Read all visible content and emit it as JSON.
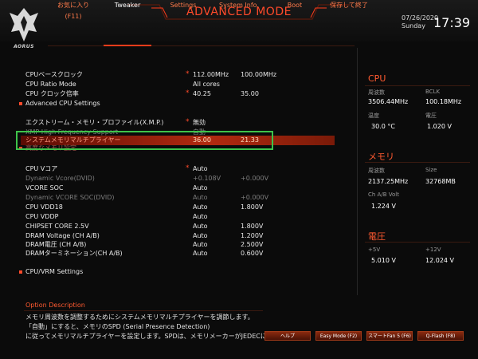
{
  "brand": {
    "logo_text": "AORUS"
  },
  "header": {
    "mode_title": "ADVANCED MODE",
    "date": "07/26/2020",
    "day": "Sunday",
    "time": "17:39"
  },
  "tabs": [
    {
      "label": "お気に入り (F11)"
    },
    {
      "label": "Tweaker",
      "active": true
    },
    {
      "label": "Settings"
    },
    {
      "label": "System Info."
    },
    {
      "label": "Boot"
    },
    {
      "label": "保存して終了"
    }
  ],
  "settings": [
    {
      "label": "CPUベースクロック",
      "star": true,
      "v1": "112.00MHz",
      "v2": "100.00MHz"
    },
    {
      "label": "CPU Ratio Mode",
      "v1": "All cores",
      "v2": ""
    },
    {
      "label": "CPU クロック倍率",
      "star": true,
      "v1": "40.25",
      "v2": "35.00"
    },
    {
      "label": "Advanced CPU Settings"
    },
    {
      "label": "エクストリーム・メモリ・プロファイル(X.M.P.)",
      "star": true,
      "v1": "無効",
      "v2": ""
    },
    {
      "label": "XMP High Frequency Support",
      "v1": "自動",
      "v2": ""
    },
    {
      "label": "システムメモリマルチプライヤー",
      "v1": "36.00",
      "v2": "21.33"
    },
    {
      "label": "高度なメモリ設定"
    },
    {
      "label": "CPU Vコア",
      "star": true,
      "v1": "Auto",
      "v2": ""
    },
    {
      "label": "Dynamic Vcore(DVID)",
      "v1": "+0.108V",
      "v2": "+0.000V"
    },
    {
      "label": "VCORE SOC",
      "v1": "Auto",
      "v2": ""
    },
    {
      "label": "Dynamic VCORE SOC(DVID)",
      "v1": "Auto",
      "v2": "+0.000V"
    },
    {
      "label": "CPU VDD18",
      "v1": "Auto",
      "v2": "1.800V"
    },
    {
      "label": "CPU VDDP",
      "v1": "Auto",
      "v2": ""
    },
    {
      "label": "CHIPSET CORE 2.5V",
      "v1": "Auto",
      "v2": "1.800V"
    },
    {
      "label": "DRAM Voltage     (CH A/B)",
      "v1": "Auto",
      "v2": "1.200V"
    },
    {
      "label": "DRAM電圧      (CH A/B)",
      "v1": "Auto",
      "v2": "2.500V"
    },
    {
      "label": "DRAMターミネーション(CH A/B)",
      "v1": "Auto",
      "v2": "0.600V"
    },
    {
      "label": "CPU/VRM Settings"
    }
  ],
  "side": {
    "cpu": {
      "title": "CPU",
      "freq_label": "周波数",
      "freq": "3506.44MHz",
      "bclk_label": "BCLK",
      "bclk": "100.18MHz",
      "temp_label": "温度",
      "temp": "30.0 °C",
      "volt_label": "電圧",
      "volt": "1.020 V"
    },
    "memory": {
      "title": "メモリ",
      "freq_label": "周波数",
      "freq": "2137.25MHz",
      "size_label": "Size",
      "size": "32768MB",
      "volt_label": "Ch A/B Volt",
      "volt": "1.224 V"
    },
    "voltage": {
      "title": "電圧",
      "p5_label": "+5V",
      "p5": "5.010 V",
      "p12_label": "+12V",
      "p12": "12.024 V"
    }
  },
  "option_description": {
    "title": "Option Description",
    "lines": [
      "メモリ周波数を調整するためにシステムメモリマルチプライヤーを調節します。",
      "「自動」にすると、メモリのSPD (Serial Presence Detection)",
      "に従ってメモリマルチプライヤーを設定します。SPDは、メモリメーカーがJEDECに準じ"
    ]
  },
  "footer_buttons": [
    {
      "label": "ヘルプ"
    },
    {
      "label": "Easy Mode (F2)"
    },
    {
      "label": "スマートFan 5 (F6)"
    },
    {
      "label": "Q-Flash (F8)"
    }
  ],
  "colors": {
    "accent": "#ff4a2a",
    "highlight_box": "#3ec34a",
    "background": "#0b0b0b"
  }
}
